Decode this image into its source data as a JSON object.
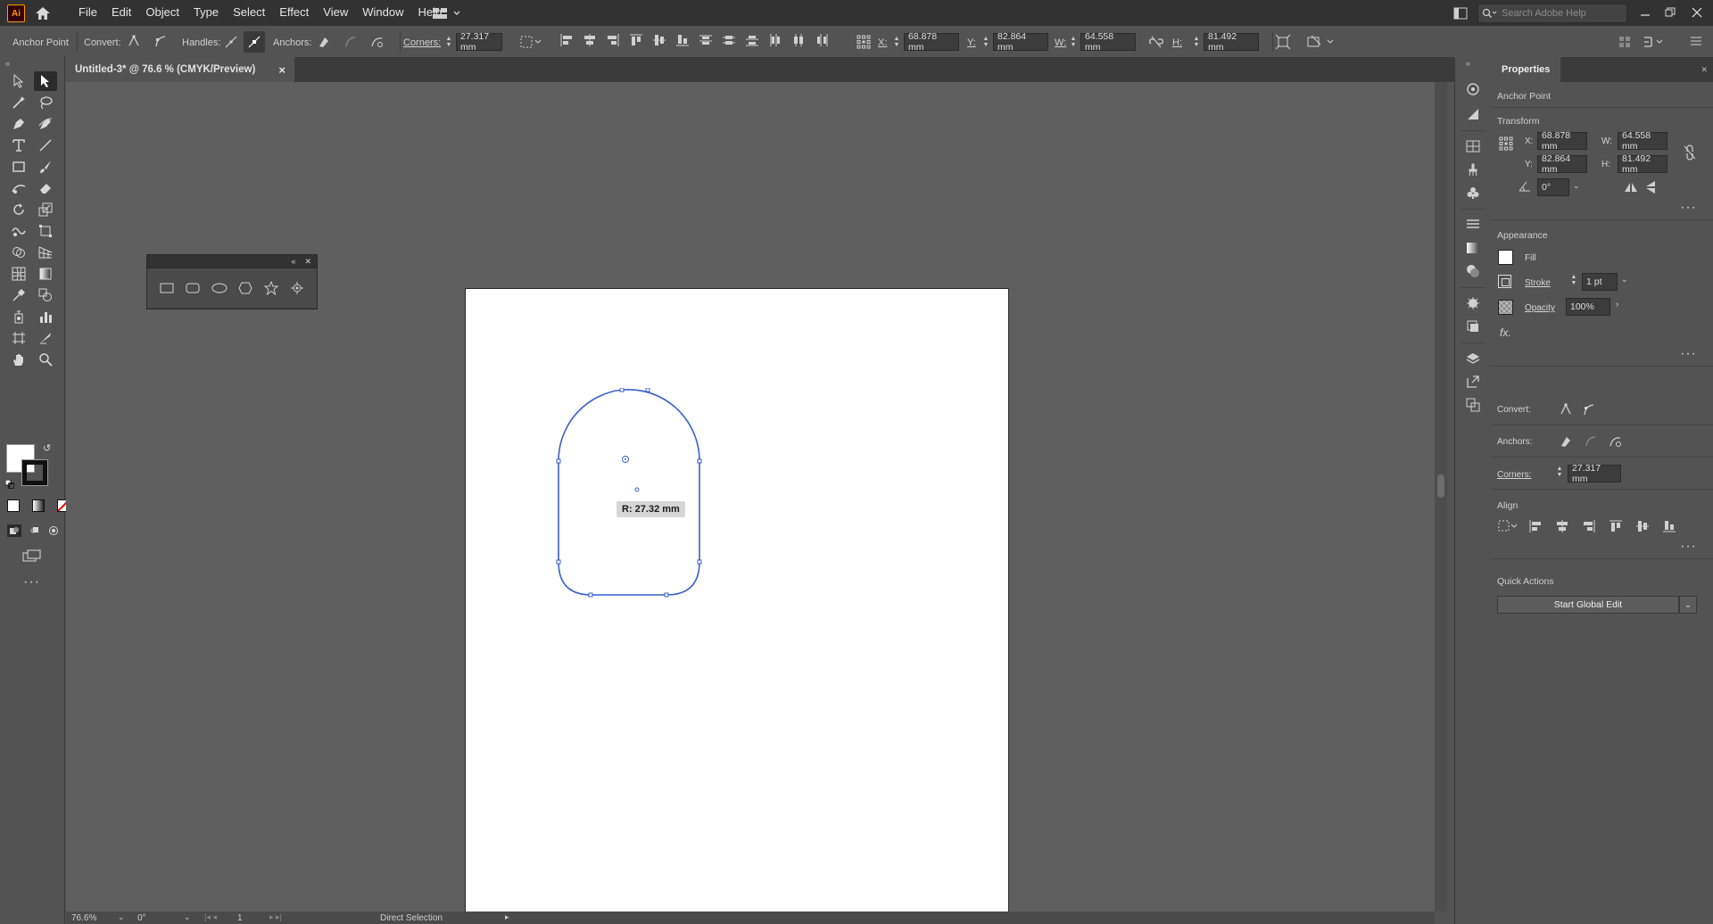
{
  "app": {
    "logo": "Ai"
  },
  "menu": [
    "File",
    "Edit",
    "Object",
    "Type",
    "Select",
    "Effect",
    "View",
    "Window",
    "Help"
  ],
  "search": {
    "placeholder": "Search Adobe Help"
  },
  "control": {
    "selection_type": "Anchor Point",
    "convert_label": "Convert:",
    "handles_label": "Handles:",
    "anchors_label": "Anchors:",
    "corners_label": "Corners:",
    "corners_value": "27.317 mm",
    "x_label": "X:",
    "x_value": "68.878 mm",
    "y_label": "Y:",
    "y_value": "82.864 mm",
    "w_label": "W:",
    "w_value": "64.558 mm",
    "h_label": "H:",
    "h_value": "81.492 mm"
  },
  "document_tab": {
    "title": "Untitled-3* @ 76.6 % (CMYK/Preview)",
    "close": "×"
  },
  "canvas": {
    "radius_tooltip": "R: 27.32 mm",
    "selection_color": "#3b5fcf"
  },
  "properties": {
    "tab": "Properties",
    "context": "Anchor Point",
    "transform_title": "Transform",
    "x_label": "X:",
    "x": "68.878 mm",
    "y_label": "Y:",
    "y": "82.864 mm",
    "w_label": "W:",
    "w": "64.558 mm",
    "h_label": "H:",
    "h": "81.492 mm",
    "angle": "0°",
    "appearance_title": "Appearance",
    "fill_label": "Fill",
    "stroke_label": "Stroke",
    "stroke_value": "1 pt",
    "opacity_label": "Opacity",
    "opacity_value": "100%",
    "fx_label": "fx.",
    "convert_label": "Convert:",
    "anchors_label": "Anchors:",
    "corners_label": "Corners:",
    "corners_value": "27.317 mm",
    "align_title": "Align",
    "quick_actions_title": "Quick Actions",
    "global_edit": "Start Global Edit"
  },
  "status": {
    "zoom": "76.6%",
    "rotation": "0°",
    "artboard": "1",
    "tool": "Direct Selection"
  }
}
